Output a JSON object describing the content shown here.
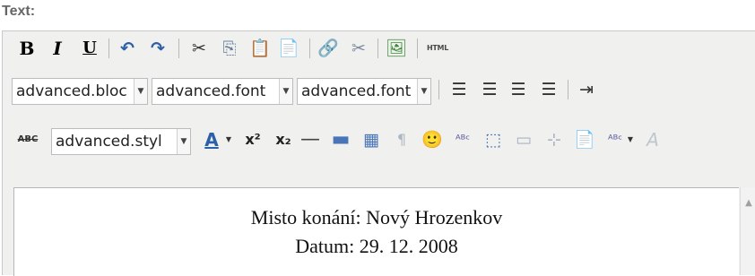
{
  "field_label": "Text:",
  "toolbar": {
    "bold": "B",
    "italic": "I",
    "underline": "U",
    "undo": "↶",
    "redo": "↷",
    "cut": "✂",
    "copy": "⎘",
    "paste": "📋",
    "paste_text": "📄",
    "link": "🔗",
    "unlink": "✂",
    "image": "🖼",
    "html": "HTML",
    "block_format": "advanced.bloc",
    "font_family": "advanced.font",
    "font_size": "advanced.font",
    "align_left": "☰",
    "align_center": "☰",
    "align_right": "☰",
    "justify": "☰",
    "indent": "⇥",
    "strike_label": "ABC",
    "style": "advanced.styl",
    "text_color": "A",
    "superscript": "x²",
    "subscript": "x₂",
    "hr": "—",
    "removeformat": "▬",
    "table": "▦",
    "pilcrow": "¶",
    "emoticon": "🙂",
    "spellcheck": "ᴬᴮᶜ",
    "anchor": "⬚",
    "layer": "▭",
    "crop": "⊹",
    "template": "📄",
    "spell2": "ᴬᴮᶜ",
    "more": "A"
  },
  "content": {
    "line1": "Misto konání: Nový Hrozenkov",
    "line2": "Datum: 29. 12. 2008"
  },
  "colors": {
    "toolbar_bg": "#f0f0ee",
    "link_blue": "#2b5fa8",
    "warm_orange": "#e3a33a",
    "smile_yellow": "#ffd83b"
  }
}
